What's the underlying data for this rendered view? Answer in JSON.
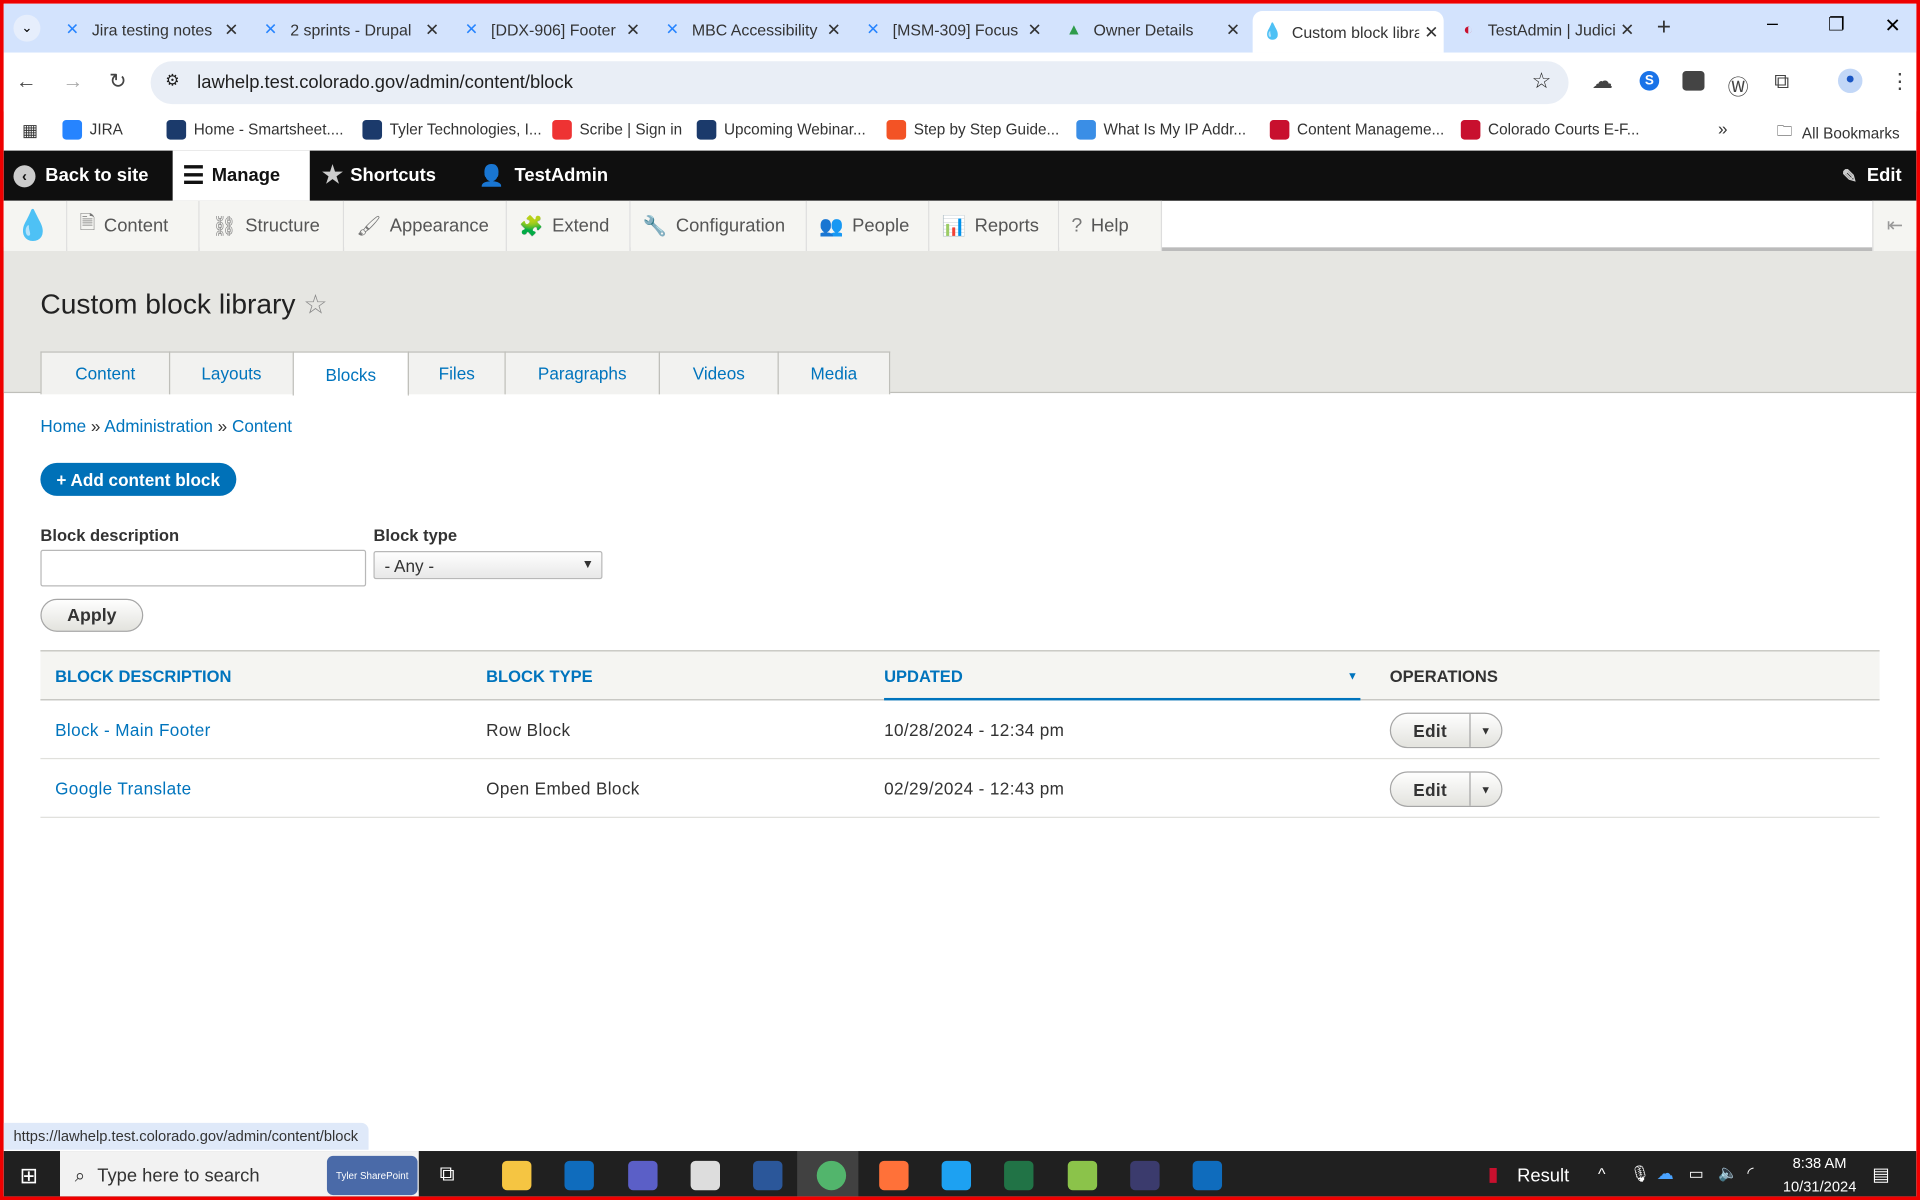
{
  "browser": {
    "tabs": [
      {
        "label": "Jira testing notes",
        "icon": "jira-icon",
        "color": "#2684ff"
      },
      {
        "label": "2 sprints - Drupal",
        "icon": "jira-icon",
        "color": "#2684ff"
      },
      {
        "label": "[DDX-906] Footer",
        "icon": "jira-icon",
        "color": "#2684ff"
      },
      {
        "label": "MBC Accessibility",
        "icon": "jira-icon",
        "color": "#2684ff"
      },
      {
        "label": "[MSM-309] Focus",
        "icon": "jira-icon",
        "color": "#2684ff"
      },
      {
        "label": "Owner Details",
        "icon": "triangle-icon",
        "color": "#2e9c4b"
      },
      {
        "label": "Custom block library",
        "icon": "drupal-icon",
        "color": "#0678be"
      },
      {
        "label": "TestAdmin | Judicial",
        "icon": "colorado-icon",
        "color": "#c8102e"
      }
    ],
    "url": "lawhelp.test.colorado.gov/admin/content/block",
    "bookmarks": [
      "JIRA",
      "Home - Smartsheet....",
      "Tyler Technologies, I...",
      "Scribe | Sign in",
      "Upcoming Webinar...",
      "Step by Step Guide...",
      "What Is My IP Addr...",
      "Content Manageme...",
      "Colorado Courts E-F..."
    ],
    "all_bookmarks": "All Bookmarks",
    "status_url": "https://lawhelp.test.colorado.gov/admin/content/block"
  },
  "toolbar": {
    "back": "Back to site",
    "manage": "Manage",
    "shortcuts": "Shortcuts",
    "user": "TestAdmin",
    "edit": "Edit"
  },
  "tray": [
    "Content",
    "Structure",
    "Appearance",
    "Extend",
    "Configuration",
    "People",
    "Reports",
    "Help"
  ],
  "page": {
    "title": "Custom block library",
    "tabs": [
      "Content",
      "Layouts",
      "Blocks",
      "Files",
      "Paragraphs",
      "Videos",
      "Media"
    ],
    "active_tab": "Blocks",
    "breadcrumb": [
      "Home",
      "Administration",
      "Content"
    ],
    "add_button": "+ Add content block",
    "filter": {
      "desc_label": "Block description",
      "desc_value": "",
      "type_label": "Block type",
      "type_value": "- Any -",
      "apply": "Apply"
    },
    "table": {
      "headers": [
        "BLOCK DESCRIPTION",
        "BLOCK TYPE",
        "UPDATED",
        "OPERATIONS"
      ],
      "sorted_by": "UPDATED",
      "rows": [
        {
          "description": "Block - Main Footer",
          "type": "Row Block",
          "updated": "10/28/2024 - 12:34 pm",
          "op": "Edit"
        },
        {
          "description": "Google Translate",
          "type": "Open Embed Block",
          "updated": "02/29/2024 - 12:43 pm",
          "op": "Edit"
        }
      ]
    }
  },
  "taskbar": {
    "search": "Type here to search",
    "pinned": "Tyler SharePoint",
    "news": "Result",
    "time": "8:38 AM",
    "date": "10/31/2024"
  }
}
